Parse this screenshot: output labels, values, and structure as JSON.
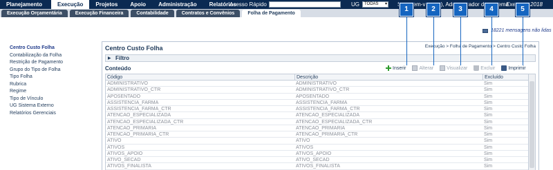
{
  "topnav": {
    "items": [
      {
        "label": "Planejamento",
        "active": false
      },
      {
        "label": "Execução",
        "active": true
      },
      {
        "label": "Projetos",
        "active": false
      },
      {
        "label": "Apoio",
        "active": false
      },
      {
        "label": "Administração",
        "active": false
      },
      {
        "label": "Relatórios",
        "active": false
      }
    ],
    "quick_access_label": "Acesso Rápido",
    "quick_access_value": "",
    "ug_label": "UG",
    "ug_value": "TODAS",
    "welcome": "Seja bem-vindo(a), Administrador do Sistema",
    "exercise": "Exercício 2018"
  },
  "tabs": [
    {
      "label": "Execução Orçamentária",
      "active": false
    },
    {
      "label": "Execução Financeira",
      "active": false
    },
    {
      "label": "Contabilidade",
      "active": false
    },
    {
      "label": "Contratos e Convênios",
      "active": false
    },
    {
      "label": "Folha de Pagamento",
      "active": true
    }
  ],
  "messages": {
    "text": "18221 mensagens não lidas",
    "icon": "envelope-icon"
  },
  "sidebar": {
    "items": [
      {
        "label": "Centro Custo Folha",
        "active": true
      },
      {
        "label": "Contabilização da Folha",
        "active": false
      },
      {
        "label": "Restrição de Pagamento",
        "active": false
      },
      {
        "label": "Grupo do Tipo de Folha",
        "active": false
      },
      {
        "label": "Tipo Folha",
        "active": false
      },
      {
        "label": "Rubrica",
        "active": false
      },
      {
        "label": "Regime",
        "active": false
      },
      {
        "label": "Tipo de Vínculo",
        "active": false
      },
      {
        "label": "UG Sistema Externo",
        "active": false
      },
      {
        "label": "Relatórios Gerenciais",
        "active": false
      }
    ]
  },
  "main": {
    "title": "Centro Custo Folha",
    "breadcrumb": "Execução > Folha de Pagamento > Centro Custo Folha",
    "filter_label": "Filtro",
    "content_label": "Conteúdo",
    "actions": [
      {
        "label": "Inserir",
        "icon": "plus-icon",
        "enabled": true
      },
      {
        "label": "Alterar",
        "icon": "document-icon",
        "enabled": false
      },
      {
        "label": "Visualizar",
        "icon": "document-view-icon",
        "enabled": false
      },
      {
        "label": "Excluir",
        "icon": "trash-icon",
        "enabled": false
      },
      {
        "label": "Imprimir",
        "icon": "printer-icon",
        "enabled": true
      }
    ],
    "table": {
      "headers": [
        "Código",
        "Descrição",
        "Excluído"
      ],
      "rows": [
        [
          "ADMINISTRATIVO",
          "ADMINISTRATIVO",
          "Sim"
        ],
        [
          "ADMINISTRATIVO_CTR",
          "ADMINISTRATIVO_CTR",
          "Sim"
        ],
        [
          "APOSENTADO",
          "APOSENTADO",
          "Sim"
        ],
        [
          "ASSISTENCIA_FARMA",
          "ASSISTENCIA_FARMA",
          "Sim"
        ],
        [
          "ASSISTENCIA_FARMA_CTR",
          "ASSISTENCIA_FARMA_CTR",
          "Sim"
        ],
        [
          "ATENCAO_ESPECIALIZADA",
          "ATENCAO_ESPECIALIZADA",
          "Sim"
        ],
        [
          "ATENCAO_ESPECIALIZADA_CTR",
          "ATENCAO_ESPECIALIZADA_CTR",
          "Sim"
        ],
        [
          "ATENCAO_PRIMARIA",
          "ATENCAO_PRIMARIA",
          "Sim"
        ],
        [
          "ATENCAO_PRIMARIA_CTR",
          "ATENCAO_PRIMARIA_CTR",
          "Sim"
        ],
        [
          "ATIVO",
          "ATIVO",
          "Sim"
        ],
        [
          "ATIVOS",
          "ATIVOS",
          "Sim"
        ],
        [
          "ATIVOS_APOIO",
          "ATIVOS_APOIO",
          "Sim"
        ],
        [
          "ATIVO_SECAD",
          "ATIVO_SECAD",
          "Sim"
        ],
        [
          "ATIVOS_FINALISTA",
          "ATIVOS_FINALISTA",
          "Sim"
        ]
      ]
    }
  },
  "markers": [
    "1",
    "2",
    "3",
    "4",
    "5"
  ],
  "colors": {
    "topbar": "#0b2a52",
    "marker": "#1565c0",
    "accent": "#2d9a2d"
  }
}
